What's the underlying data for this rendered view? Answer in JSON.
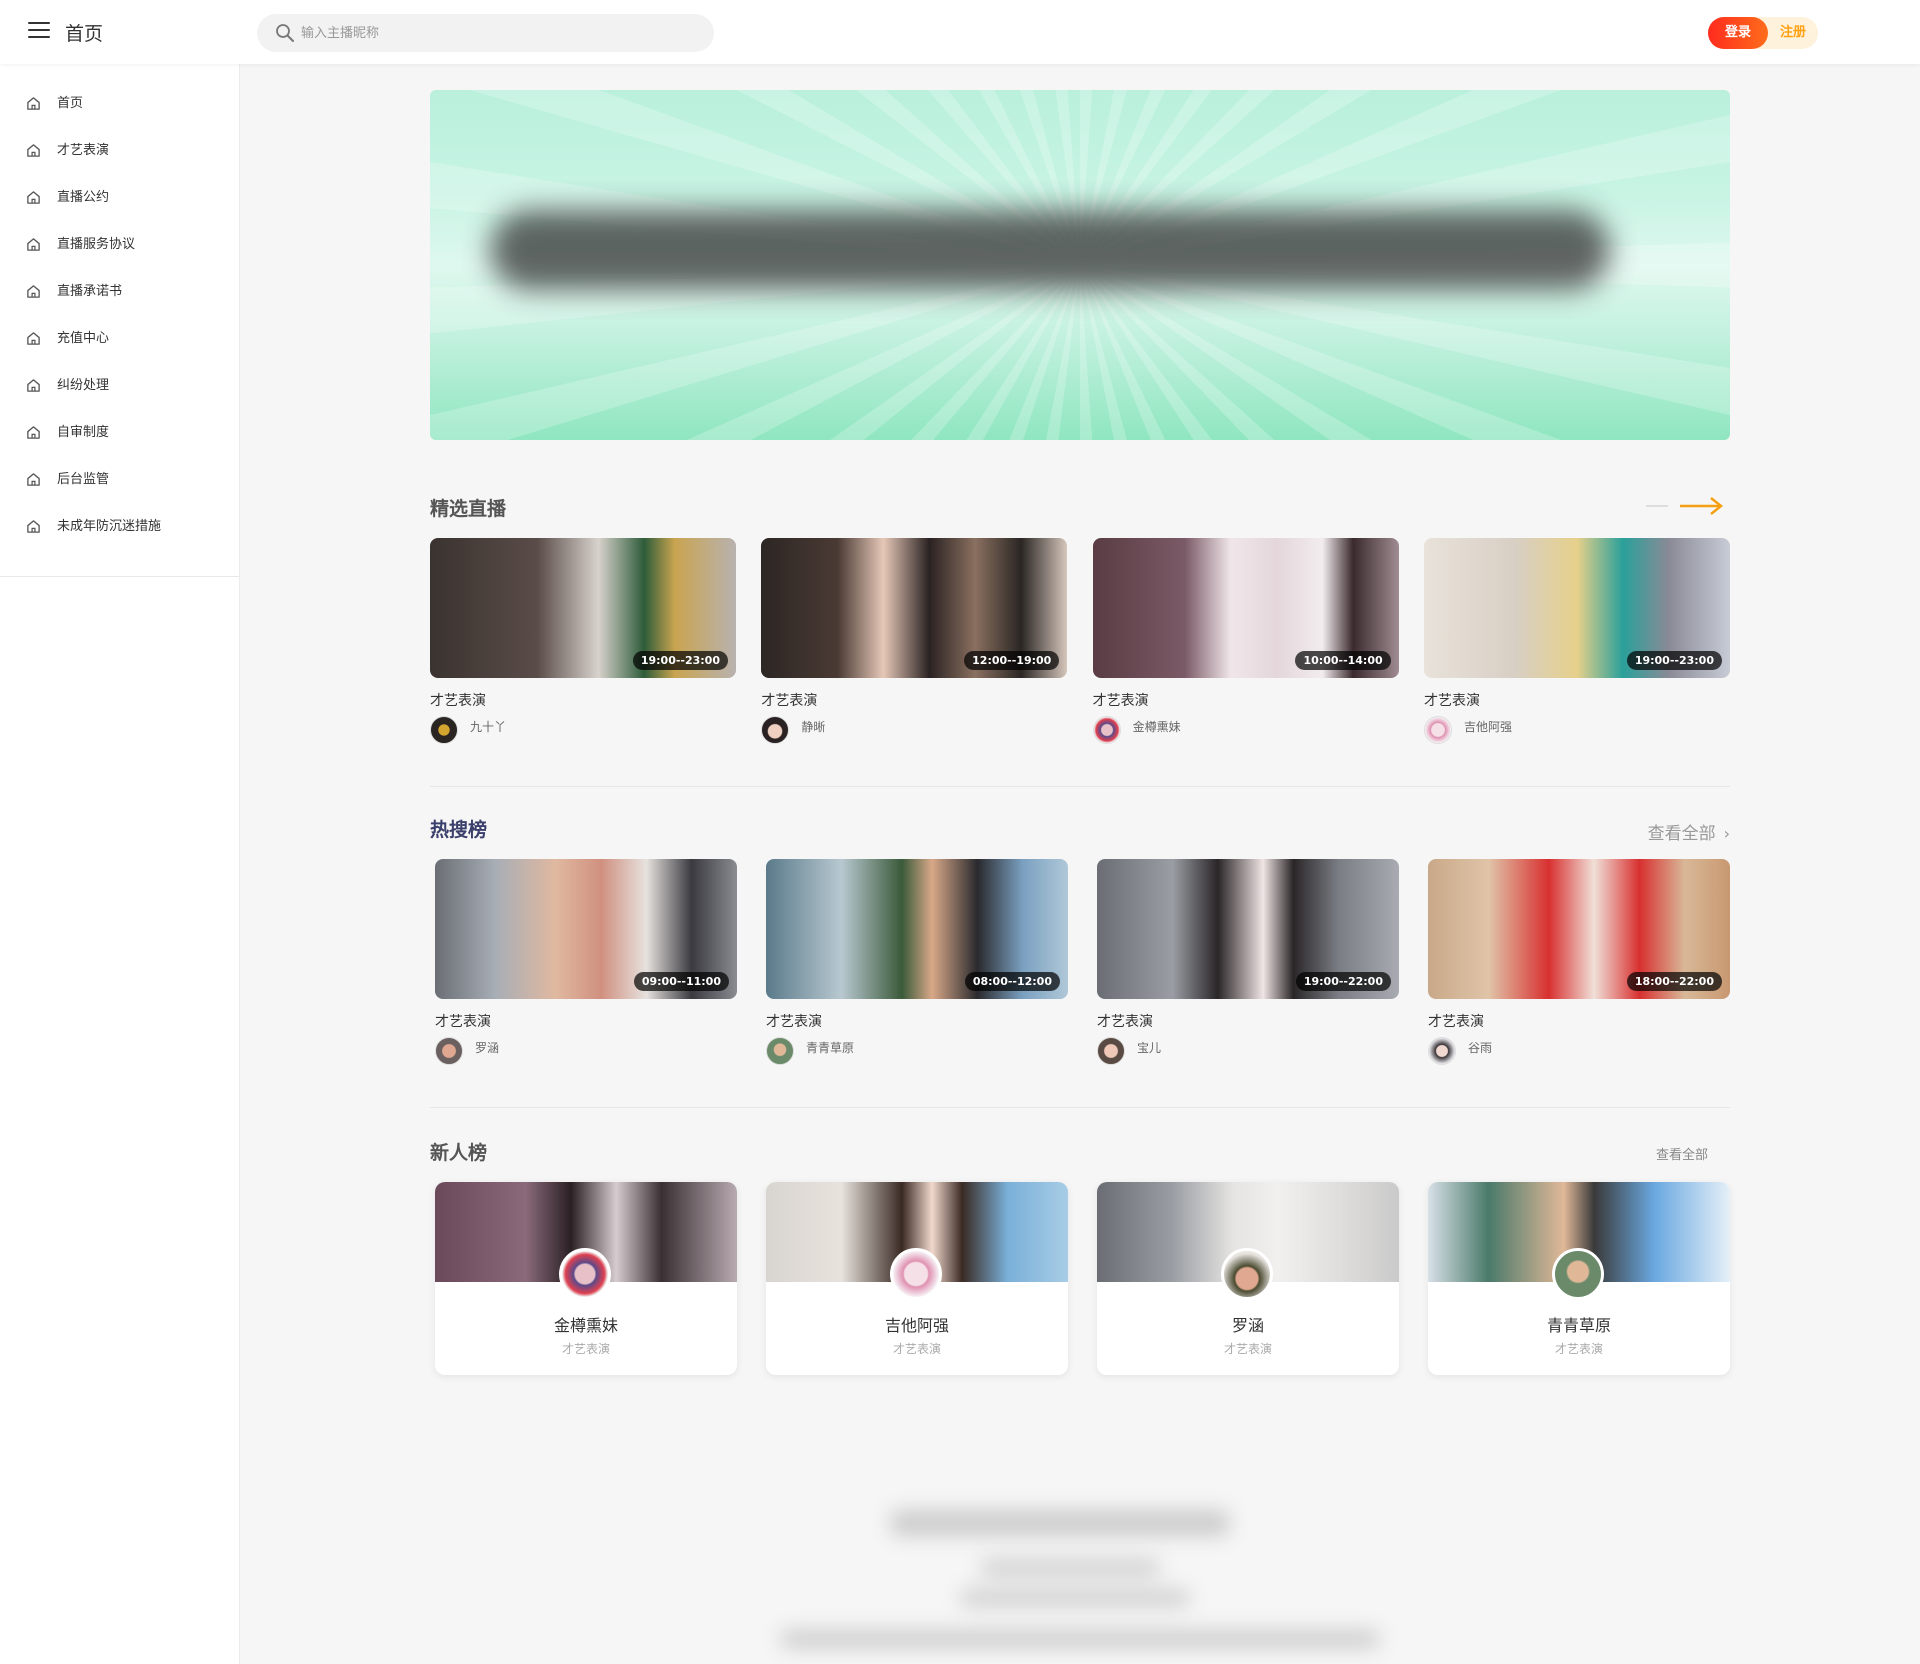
{
  "header": {
    "title": "首页",
    "search_placeholder": "输入主播昵称",
    "login_label": "登录",
    "register_label": "注册"
  },
  "sidebar": {
    "items": [
      {
        "label": "首页"
      },
      {
        "label": "才艺表演"
      },
      {
        "label": "直播公约"
      },
      {
        "label": "直播服务协议"
      },
      {
        "label": "直播承诺书"
      },
      {
        "label": "充值中心"
      },
      {
        "label": "纠纷处理"
      },
      {
        "label": "自审制度"
      },
      {
        "label": "后台监管"
      },
      {
        "label": "未成年防沉迷措施"
      }
    ]
  },
  "featured": {
    "title": "精选直播",
    "cards": [
      {
        "time": "19:00--23:00",
        "category": "才艺表演",
        "name": "九十丫"
      },
      {
        "time": "12:00--19:00",
        "category": "才艺表演",
        "name": "静晰"
      },
      {
        "time": "10:00--14:00",
        "category": "才艺表演",
        "name": "金樽熏妹"
      },
      {
        "time": "19:00--23:00",
        "category": "才艺表演",
        "name": "吉他阿强"
      }
    ]
  },
  "hot": {
    "title": "热搜榜",
    "view_all": "查看全部",
    "cards": [
      {
        "time": "09:00--11:00",
        "category": "才艺表演",
        "name": "罗涵"
      },
      {
        "time": "08:00--12:00",
        "category": "才艺表演",
        "name": "青青草原"
      },
      {
        "time": "19:00--22:00",
        "category": "才艺表演",
        "name": "宝儿"
      },
      {
        "time": "18:00--22:00",
        "category": "才艺表演",
        "name": "谷雨"
      }
    ]
  },
  "newcomers": {
    "title": "新人榜",
    "view_all": "查看全部",
    "cards": [
      {
        "name": "金樽熏妹",
        "category": "才艺表演"
      },
      {
        "name": "吉他阿强",
        "category": "才艺表演"
      },
      {
        "name": "罗涵",
        "category": "才艺表演"
      },
      {
        "name": "青青草原",
        "category": "才艺表演"
      }
    ]
  },
  "colors": {
    "accent_orange": "#ffa112",
    "login_red": "#ff2b1e",
    "banner_green": "#8fe6c0"
  }
}
